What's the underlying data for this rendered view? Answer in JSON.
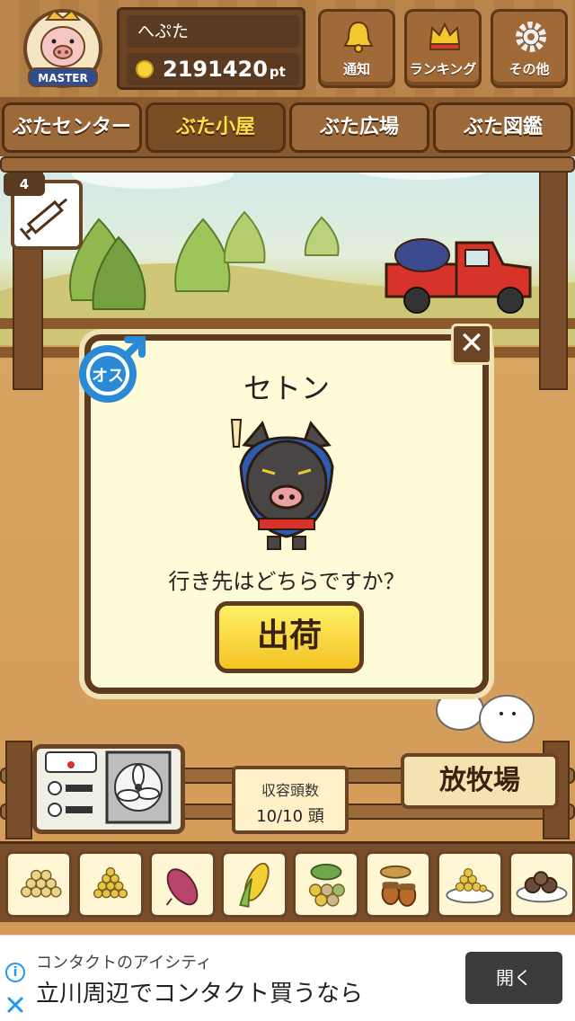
{
  "header": {
    "badge_label": "MASTER",
    "player_name": "へぷた",
    "points": "2191420",
    "points_unit": "pt",
    "buttons": [
      {
        "label": "通知",
        "icon": "bell-icon"
      },
      {
        "label": "ランキング",
        "icon": "crown-icon"
      },
      {
        "label": "その他",
        "icon": "gear-icon"
      }
    ]
  },
  "tabs": [
    {
      "label": "ぶたセンター",
      "active": false
    },
    {
      "label": "ぶた小屋",
      "active": true
    },
    {
      "label": "ぶた広場",
      "active": false
    },
    {
      "label": "ぶた図鑑",
      "active": false
    }
  ],
  "syringe": {
    "count": "4",
    "icon": "syringe-icon"
  },
  "dialog": {
    "gender_label": "オス",
    "pig_name": "セトン",
    "question": "行き先はどちらですか？",
    "ship_button": "出荷",
    "close_label": "✕"
  },
  "capacity": {
    "label": "収容頭数",
    "value": "10/10 頭"
  },
  "pasture_sign": "放牧場",
  "feeds": [
    {
      "icon": "soybeans-icon"
    },
    {
      "icon": "grain-pile-icon"
    },
    {
      "icon": "sweet-potato-icon"
    },
    {
      "icon": "corn-icon"
    },
    {
      "icon": "mixed-beans-icon"
    },
    {
      "icon": "acorn-icon"
    },
    {
      "icon": "grain-bowl-icon"
    },
    {
      "icon": "meatball-plate-icon"
    }
  ],
  "ad": {
    "line1": "コンタクトのアイシティ",
    "line2": "立川周辺でコンタクト買うなら",
    "open_button": "開く"
  },
  "colors": {
    "wood": "#7a4e2a",
    "dialog_bg": "#fffbd8",
    "button_yellow": "#f3c322",
    "tab_active_text": "#ffe04a",
    "gender_blue": "#2a8ad6"
  }
}
